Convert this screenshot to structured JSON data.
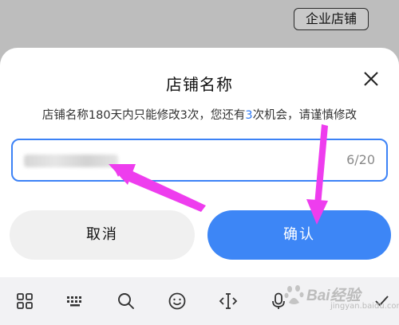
{
  "header": {
    "shop_type_label": "企业店铺"
  },
  "dialog": {
    "title": "店铺名称",
    "hint_prefix": "店铺名称180天内只能修改3次，您还有",
    "hint_count": "3",
    "hint_suffix": "次机会，请谨慎修改",
    "name_input": {
      "value": "",
      "counter": "6/20"
    },
    "cancel_label": "取消",
    "confirm_label": "确认"
  },
  "keyboard_toolbar": {
    "icons": [
      "grid-icon",
      "keyboard-icon",
      "search-icon",
      "emoji-icon",
      "cursor-icon",
      "microphone-icon",
      "collapse-icon"
    ]
  },
  "watermark": {
    "text": "Bai经验",
    "sub": "jingyan.baidu.com"
  },
  "colors": {
    "accent": "#3d86f6",
    "annotation_arrow": "#ee3dee"
  }
}
